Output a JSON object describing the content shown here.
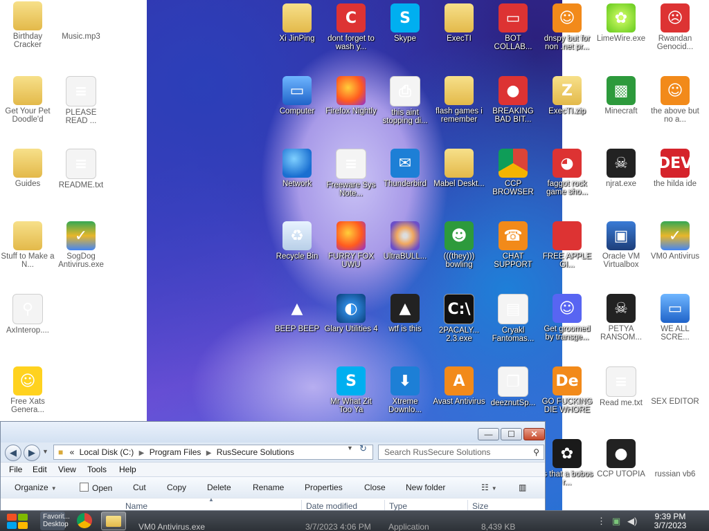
{
  "desktop": {
    "icons_left": [
      {
        "label": "Birthday Cracker",
        "icon": "folder-icon"
      },
      {
        "label": "Music.mp3",
        "icon": "vlc-icon"
      },
      {
        "label": "Get Your Pet Doodle'd",
        "icon": "folder-icon"
      },
      {
        "label": "PLEASE READ ...",
        "icon": "document-icon"
      },
      {
        "label": "Guides",
        "icon": "folder-icon"
      },
      {
        "label": "README.txt",
        "icon": "document-icon"
      },
      {
        "label": "Stuff to Make a N...",
        "icon": "folder-icon"
      },
      {
        "label": "SogDog Antivirus.exe",
        "icon": "shield-icon"
      },
      {
        "label": "AxInterop....",
        "icon": "magnifier-icon"
      },
      {
        "label": "Free Xats Genera...",
        "icon": "smiley-icon"
      }
    ],
    "icons_center": [
      {
        "label": "Xi JinPing",
        "icon": "folder-icon"
      },
      {
        "label": "dont forget to wash y...",
        "icon": "ccleaner-icon"
      },
      {
        "label": "Skype",
        "icon": "skype-icon"
      },
      {
        "label": "ExecTI",
        "icon": "folder-icon"
      },
      {
        "label": "BOT COLLAB...",
        "icon": "monitor-icon"
      },
      {
        "label": "Computer",
        "icon": "computer-icon"
      },
      {
        "label": "Firefox Nightly",
        "icon": "firefox-icon"
      },
      {
        "label": "this aint stopping di...",
        "icon": "scanner-icon"
      },
      {
        "label": "flash games i remember",
        "icon": "folder-icon"
      },
      {
        "label": "BREAKING BAD BIT...",
        "icon": "angry-birds-icon"
      },
      {
        "label": "Network",
        "icon": "network-icon"
      },
      {
        "label": "Freeware Sys Note...",
        "icon": "document-icon"
      },
      {
        "label": "Thunderbird",
        "icon": "thunderbird-icon"
      },
      {
        "label": "Mabel Deskt...",
        "icon": "folder-icon"
      },
      {
        "label": "CCP BROWSER",
        "icon": "chrome-icon"
      },
      {
        "label": "Recycle Bin",
        "icon": "recycle-bin-icon"
      },
      {
        "label": "FURRY FOX UWU",
        "icon": "firefox-icon"
      },
      {
        "label": "UltraBULL...",
        "icon": "cd-icon"
      },
      {
        "label": "(((they))) bowling",
        "icon": "game-icon"
      },
      {
        "label": "CHAT SUPPORT",
        "icon": "support-icon"
      },
      {
        "label": "BEEP BEEP",
        "icon": "vlc-icon"
      },
      {
        "label": "Glary Utilities 4",
        "icon": "glary-icon"
      },
      {
        "label": "wtf is this",
        "icon": "aimp-icon"
      },
      {
        "label": "2PACALY... 2.3.exe",
        "icon": "cmd-icon"
      },
      {
        "label": "Cryakl Fantomas...",
        "icon": "window-icon"
      },
      {
        "label": "Mr What Zit Too Ya",
        "icon": "skype-icon"
      },
      {
        "label": "Xtreme Downlo...",
        "icon": "download-icon"
      },
      {
        "label": "Avast Antivirus",
        "icon": "avast-icon"
      },
      {
        "label": "deeznutSp...",
        "icon": "copy-icon"
      }
    ],
    "icons_right": [
      {
        "label": "dnspy but for non .net pr...",
        "icon": "portrait-icon"
      },
      {
        "label": "LimeWire.exe",
        "icon": "limewire-icon"
      },
      {
        "label": "Rwandan Genocid...",
        "icon": "meme-icon"
      },
      {
        "label": "ExecTI.zip",
        "icon": "zip-folder-icon"
      },
      {
        "label": "Minecraft",
        "icon": "minecraft-icon"
      },
      {
        "label": "the above but no a...",
        "icon": "portrait-icon"
      },
      {
        "label": "faggot rock game sho...",
        "icon": "pig-icon"
      },
      {
        "label": "njrat.exe",
        "icon": "skull-icon"
      },
      {
        "label": "the hilda ide",
        "icon": "devcpp-icon"
      },
      {
        "label": "FREE APPLE GI...",
        "icon": "apple-icon"
      },
      {
        "label": "Oracle VM Virtualbox",
        "icon": "virtualbox-icon"
      },
      {
        "label": "VM0 Antivirus",
        "icon": "shield-icon"
      },
      {
        "label": "Get groomed by transge...",
        "icon": "discord-icon"
      },
      {
        "label": "PETYA RANSOM...",
        "icon": "skull-icon"
      },
      {
        "label": "WE ALL SCRE...",
        "icon": "computer-icon"
      },
      {
        "label": "GO FUCKING DIE WHORE",
        "icon": "dreamweaver-icon"
      },
      {
        "label": "Read me.txt",
        "icon": "document-icon"
      },
      {
        "label": "SEX EDITOR",
        "icon": "hxd-icon"
      },
      {
        "label": "is that a bobos r...",
        "icon": "icq-icon"
      },
      {
        "label": "CCP UTOPIA",
        "icon": "utopia-icon"
      },
      {
        "label": "russian vb6",
        "icon": "seven-icon"
      }
    ]
  },
  "explorer": {
    "title_buttons": {
      "minimize": "—",
      "maximize": "☐",
      "close": "✕"
    },
    "address": {
      "prefix": "«",
      "crumbs": [
        "Local Disk (C:)",
        "Program Files",
        "RusSecure Solutions"
      ]
    },
    "search_placeholder": "Search RusSecure Solutions",
    "menu": [
      "File",
      "Edit",
      "View",
      "Tools",
      "Help"
    ],
    "toolbar": [
      "Organize",
      "Open",
      "Cut",
      "Copy",
      "Delete",
      "Rename",
      "Properties",
      "Close",
      "New folder"
    ],
    "columns": [
      "Name",
      "Date modified",
      "Type",
      "Size"
    ],
    "sidebar_items": [
      "Favorit...",
      "Desktop"
    ],
    "rows": [
      {
        "name": "VM0 Antivirus.exe",
        "date": "3/7/2023 4:06 PM",
        "type": "Application",
        "size": "8,439 KB"
      }
    ]
  },
  "taskbar": {
    "clock_time": "9:39 PM",
    "clock_date": "3/7/2023"
  },
  "colors": {
    "win_accent": "#dfe9f5",
    "close_red": "#c74a2c",
    "taskbar": "#2c3036"
  }
}
